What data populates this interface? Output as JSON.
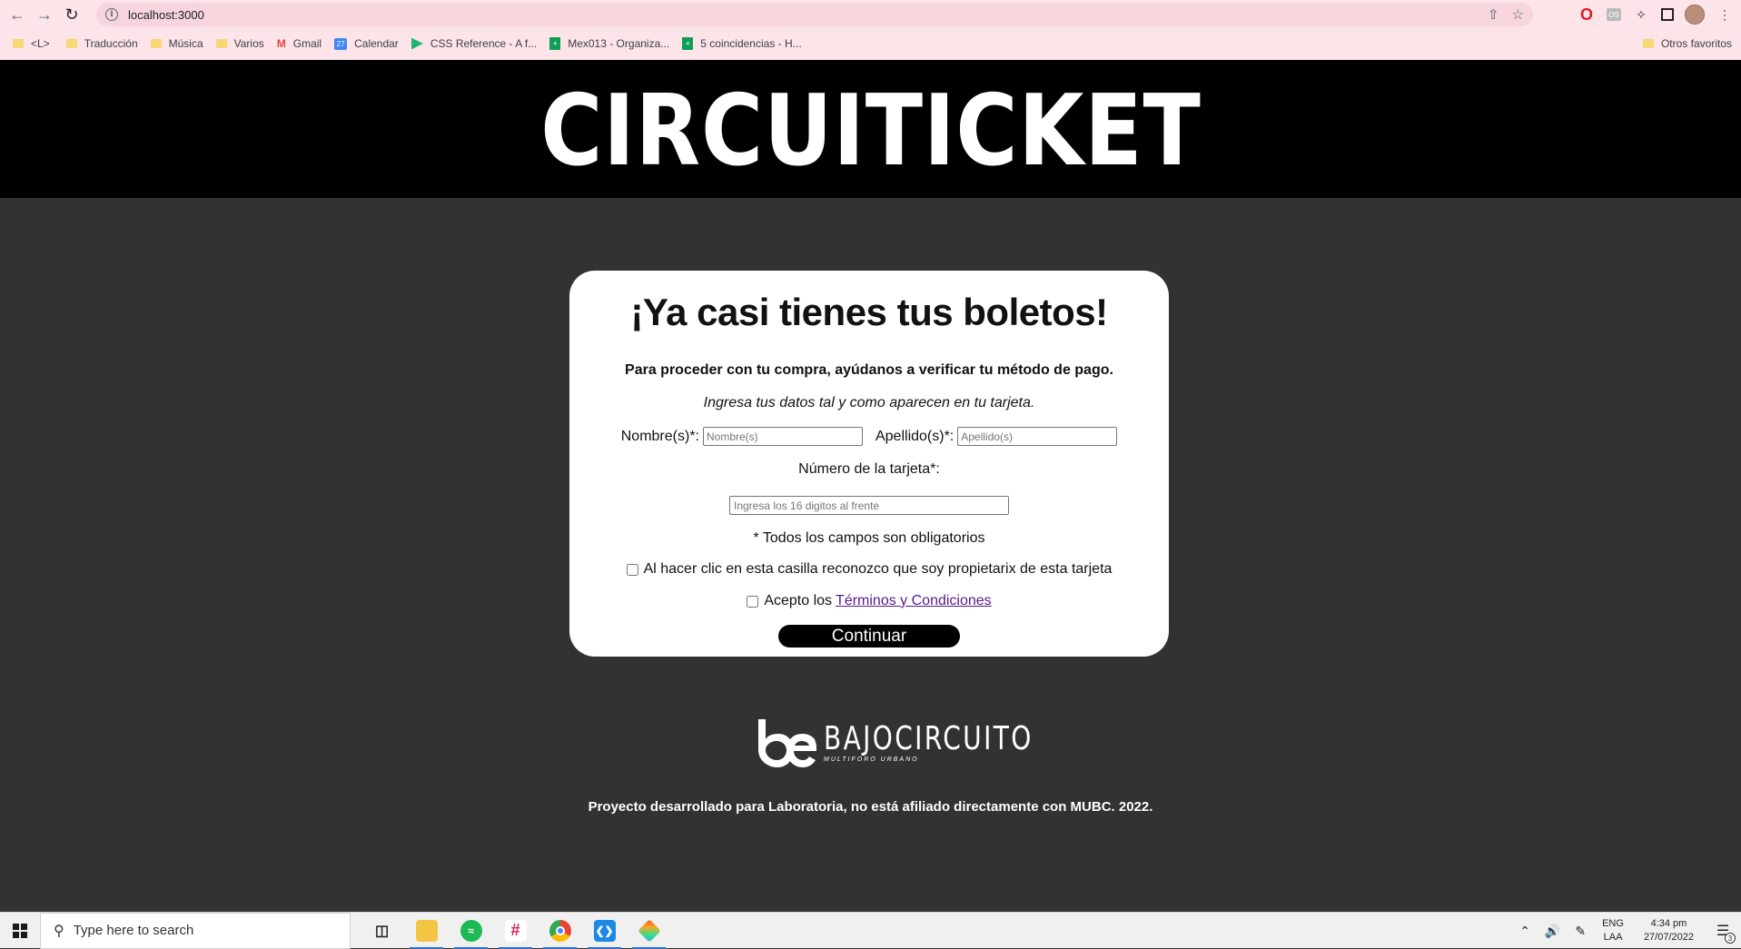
{
  "browser": {
    "url": "localhost:3000",
    "bookmarks": [
      {
        "label": "<L>",
        "icon": "folder-icon"
      },
      {
        "label": "Traducción",
        "icon": "folder-icon"
      },
      {
        "label": "Música",
        "icon": "folder-icon"
      },
      {
        "label": "Varios",
        "icon": "folder-icon"
      },
      {
        "label": "Gmail",
        "icon": "gmail-icon"
      },
      {
        "label": "Calendar",
        "icon": "calendar-icon"
      },
      {
        "label": "CSS Reference - A f...",
        "icon": "css-reference-icon"
      },
      {
        "label": "Mex013 - Organiza...",
        "icon": "sheets-icon"
      },
      {
        "label": "5 coincidencias - H...",
        "icon": "sheets-icon"
      }
    ],
    "other_bookmarks": "Otros favoritos"
  },
  "header": {
    "brand": "CIRCUITICKET"
  },
  "card": {
    "title": "¡Ya casi tienes tus boletos!",
    "lead": "Para proceder con tu compra, ayúdanos a verificar tu método de pago.",
    "hint": "Ingresa tus datos tal y como aparecen en tu tarjeta.",
    "first_name_label": "Nombre(s)*:",
    "first_name_placeholder": "Nombre(s)",
    "last_name_label": "Apellido(s)*:",
    "last_name_placeholder": "Apellido(s)",
    "card_number_label": "Número de la tarjeta*:",
    "card_number_placeholder": "Ingresa los 16 digitos al frente",
    "required_note": "* Todos los campos son obligatorios",
    "owner_checkbox_label": "Al hacer clic en esta casilla reconozco que soy propietarix de esta tarjeta",
    "terms_prefix": "Acepto los",
    "terms_link": "Términos y Condiciones",
    "continue_label": "Continuar"
  },
  "footer": {
    "logo_main": "BAJOCIRCUITO",
    "logo_sub": "MULTIFORO URBANO",
    "note": "Proyecto desarrollado para Laboratoria, no está afiliado directamente con MUBC. 2022."
  },
  "taskbar": {
    "search_placeholder": "Type here to search",
    "lang_1": "ENG",
    "lang_2": "LAA",
    "time": "4:34 pm",
    "date": "27/07/2022",
    "notifications": "3"
  }
}
